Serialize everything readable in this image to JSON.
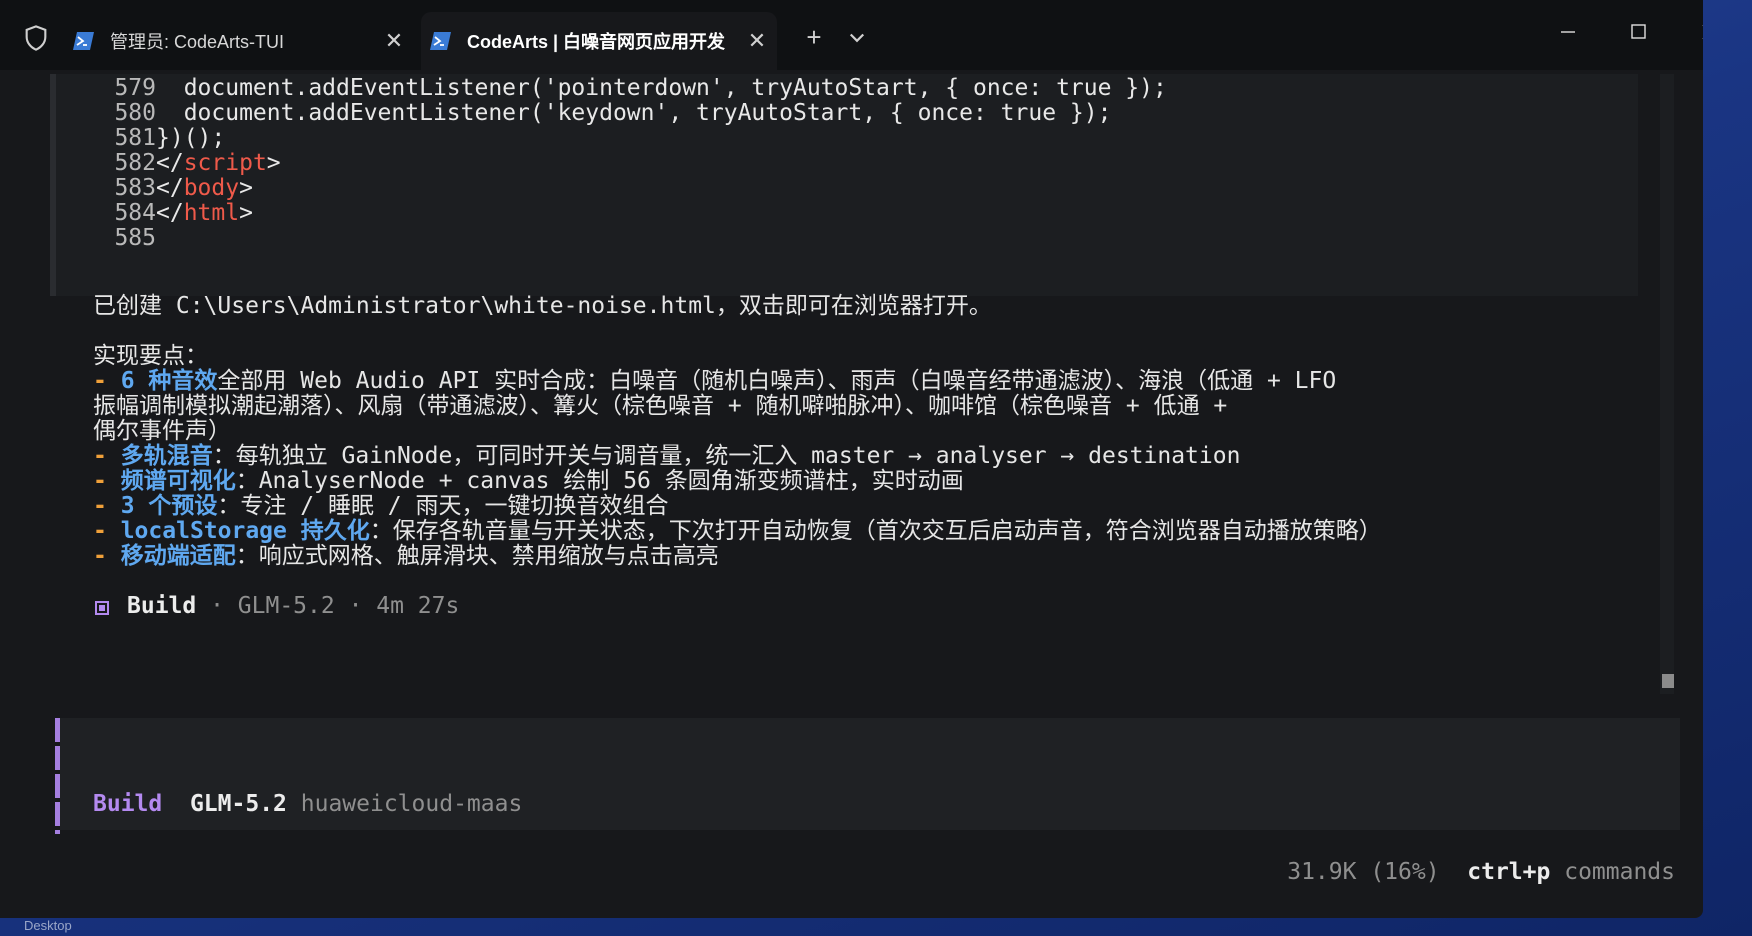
{
  "window": {
    "tabs": [
      {
        "label": "管理员: CodeArts-TUI",
        "active": false
      },
      {
        "label": "CodeArts | 白噪音网页应用开发",
        "active": true
      }
    ],
    "new_tab_symbol": "+",
    "close_symbol": "✕"
  },
  "code": {
    "lines": [
      {
        "num": "579",
        "text": "  document.addEventListener('pointerdown', tryAutoStart, { once: true });"
      },
      {
        "num": "580",
        "text": "  document.addEventListener('keydown', tryAutoStart, { once: true });"
      },
      {
        "num": "581",
        "text": "})();"
      },
      {
        "num": "582",
        "open": "</",
        "tag": "script",
        "close": ">"
      },
      {
        "num": "583",
        "open": "</",
        "tag": "body",
        "close": ">"
      },
      {
        "num": "584",
        "open": "</",
        "tag": "html",
        "close": ">"
      },
      {
        "num": "585",
        "text": ""
      }
    ]
  },
  "message": {
    "created": "已创建 C:\\Users\\Administrator\\white-noise.html，双击即可在浏览器打开。",
    "points_title": "实现要点：",
    "bullets": [
      {
        "dash": "- ",
        "highlight": "6 种音效",
        "text": "全部用 Web Audio API 实时合成：白噪音（随机白噪声）、雨声（白噪音经带通滤波）、海浪（低通 + LFO"
      },
      {
        "cont": true,
        "text": "振幅调制模拟潮起潮落）、风扇（带通滤波）、篝火（棕色噪音 + 随机噼啪脉冲）、咖啡馆（棕色噪音 + 低通 +"
      },
      {
        "cont": true,
        "text": "偶尔事件声）"
      },
      {
        "dash": "- ",
        "highlight": "多轨混音",
        "text": "：每轨独立 GainNode，可同时开关与调音量，统一汇入 master → analyser → destination"
      },
      {
        "dash": "- ",
        "highlight": "频谱可视化",
        "text": "：AnalyserNode + canvas 绘制 56 条圆角渐变频谱柱，实时动画"
      },
      {
        "dash": "- ",
        "highlight": "3 个预设",
        "text": "：专注 / 睡眠 / 雨天，一键切换音效组合"
      },
      {
        "dash": "- ",
        "highlight": "localStorage 持久化",
        "text": "：保存各轨音量与开关状态，下次打开自动恢复（首次交互后启动声音，符合浏览器自动播放策略）"
      },
      {
        "dash": "- ",
        "highlight": "移动端适配",
        "text": "：响应式网格、触屏滑块、禁用缩放与点击高亮"
      }
    ],
    "footer": {
      "label": "Build",
      "detail": " · GLM-5.2 · 4m 27s"
    }
  },
  "prompt": {
    "mode": "Build",
    "model": "GLM-5.2",
    "provider": "huaweicloud-maas"
  },
  "status": {
    "tokens": "31.9K (16%)",
    "shortcut": "ctrl+p",
    "shortcut_desc": "commands"
  },
  "desktop": {
    "label": "Desktop"
  }
}
